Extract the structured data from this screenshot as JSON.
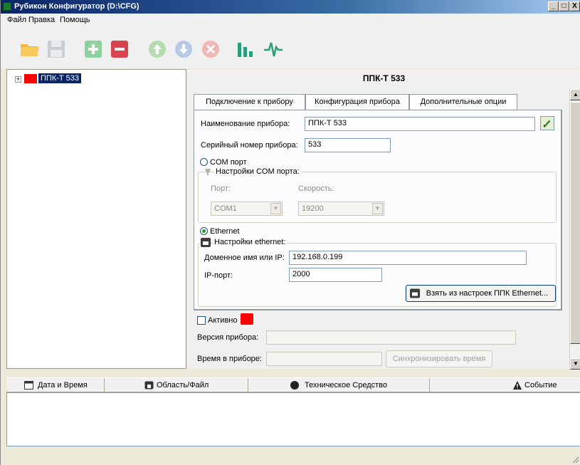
{
  "window": {
    "title": "Рубикон Конфигуратор (D:\\CFG)",
    "minimize": "_",
    "maximize": "□",
    "close": "X"
  },
  "menu": {
    "file": "Файл",
    "edit": "Правка",
    "help": "Помощь"
  },
  "toolbar": {
    "icons": [
      "open-folder-icon",
      "save-icon",
      "add-icon",
      "remove-icon",
      "up-icon",
      "down-icon",
      "delete-icon",
      "chart-bars-icon",
      "pulse-icon"
    ]
  },
  "tree": {
    "expander": "+",
    "item": "ППК-Т 533"
  },
  "device": {
    "title": "ППК-Т 533"
  },
  "tabs": {
    "connection": "Подключение к прибору",
    "config": "Конфигурация прибора",
    "extra": "Дополнительные опции"
  },
  "form": {
    "name_label": "Наименование прибора:",
    "name_value": "ППК-Т 533",
    "serial_label": "Серийный номер прибора:",
    "serial_value": "533",
    "com_radio": "COM порт",
    "com_group": "Настройки COM порта:",
    "port_label": "Порт:",
    "port_value": "COM1",
    "speed_label": "Скорость:",
    "speed_value": "19200",
    "eth_radio": "Ethernet",
    "eth_group": "Настройки ethernet:",
    "host_label": "Доменное имя или IP:",
    "host_value": "192.168.0.199",
    "ipport_label": "IP-порт:",
    "ipport_value": "2000",
    "fetch_button": "Взять из настроек ППК Ethernet..."
  },
  "status": {
    "active_label": "Активно",
    "version_label": "Версия прибора:",
    "version_value": "",
    "time_label": "Время в приборе:",
    "time_value": "",
    "sync_button": "Синхронизировать время"
  },
  "events": {
    "col_datetime": "Дата и Время",
    "col_area": "Область/Файл",
    "col_device": "Техническое Средство",
    "col_event": "Событие"
  }
}
